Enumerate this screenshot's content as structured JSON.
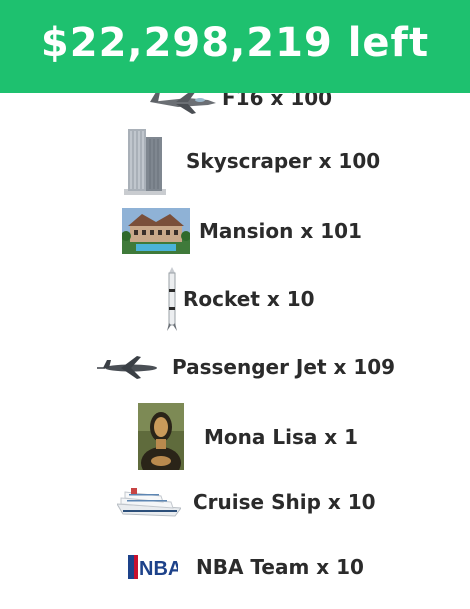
{
  "header": {
    "amount_text": "$22,298,219 left",
    "background_color": "#1ec16f"
  },
  "purchases": [
    {
      "name": "F16",
      "label": "F16 x 100",
      "quantity": 100,
      "icon": "f16-jet-icon"
    },
    {
      "name": "Skyscraper",
      "label": "Skyscraper x 100",
      "quantity": 100,
      "icon": "skyscraper-icon"
    },
    {
      "name": "Mansion",
      "label": "Mansion x 101",
      "quantity": 101,
      "icon": "mansion-icon"
    },
    {
      "name": "Rocket",
      "label": "Rocket x 10",
      "quantity": 10,
      "icon": "rocket-icon"
    },
    {
      "name": "Passenger Jet",
      "label": "Passenger Jet x 109",
      "quantity": 109,
      "icon": "passenger-jet-icon"
    },
    {
      "name": "Mona Lisa",
      "label": "Mona Lisa x 1",
      "quantity": 1,
      "icon": "mona-lisa-icon"
    },
    {
      "name": "Cruise Ship",
      "label": "Cruise Ship x 10",
      "quantity": 10,
      "icon": "cruise-ship-icon"
    },
    {
      "name": "NBA Team",
      "label": "NBA Team x 10",
      "quantity": 10,
      "icon": "nba-logo-icon"
    }
  ]
}
